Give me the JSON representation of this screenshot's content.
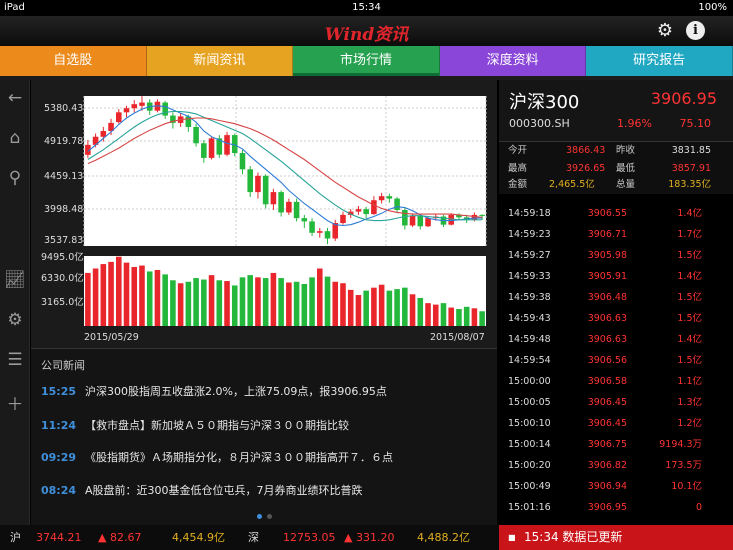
{
  "status_bar": {
    "device": "iPad",
    "time": "15:34",
    "battery": "100%"
  },
  "app": {
    "logo_text": "Wind资讯",
    "settings_icon": "gear-icon",
    "info_icon": "info-icon"
  },
  "tabs": [
    {
      "label": "自选股",
      "color": "#ec8a1c"
    },
    {
      "label": "新闻资讯",
      "color": "#e6a322"
    },
    {
      "label": "市场行情",
      "color": "#26a14f",
      "active": true
    },
    {
      "label": "深度资料",
      "color": "#8a46d8"
    },
    {
      "label": "研究报告",
      "color": "#20a7c1"
    }
  ],
  "sidebar_icons": [
    "back-arrow-icon",
    "home-icon",
    "search-icon",
    "chart-icon",
    "settings-icon",
    "list-icon",
    "add-icon"
  ],
  "chart": {
    "price_axis_labels": [
      "5380.43",
      "4919.78",
      "4459.13",
      "3998.48",
      "3537.83"
    ],
    "volume_axis_labels": [
      "9495.0亿",
      "6330.0亿",
      "3165.0亿"
    ],
    "start_date": "2015/05/29",
    "end_date": "2015/08/07"
  },
  "chart_data": {
    "type": "candlestick",
    "ylim": [
      3537.83,
      5380.43
    ],
    "volume_ylim": [
      0,
      9495.0
    ],
    "candles": [
      [
        4658,
        4780,
        4620,
        4840,
        7200
      ],
      [
        4780,
        4880,
        4750,
        4920,
        7800
      ],
      [
        4880,
        4950,
        4820,
        5000,
        8400
      ],
      [
        4950,
        5050,
        4900,
        5100,
        8700
      ],
      [
        5060,
        5180,
        5040,
        5220,
        9400
      ],
      [
        5180,
        5230,
        5120,
        5260,
        8600
      ],
      [
        5230,
        5280,
        5180,
        5330,
        8000
      ],
      [
        5260,
        5300,
        5200,
        5380,
        8200
      ],
      [
        5300,
        5200,
        5150,
        5340,
        7400
      ],
      [
        5200,
        5310,
        5180,
        5340,
        7600
      ],
      [
        5300,
        5140,
        5100,
        5320,
        7000
      ],
      [
        5140,
        5050,
        4980,
        5180,
        6200
      ],
      [
        5050,
        5130,
        5000,
        5170,
        5800
      ],
      [
        5130,
        5000,
        4940,
        5150,
        6000
      ],
      [
        5000,
        4800,
        4760,
        5040,
        6500
      ],
      [
        4800,
        4620,
        4560,
        4840,
        6300
      ],
      [
        4620,
        4860,
        4600,
        4880,
        6900
      ],
      [
        4860,
        4660,
        4620,
        4900,
        6200
      ],
      [
        4660,
        4900,
        4640,
        4940,
        6100
      ],
      [
        4900,
        4680,
        4640,
        4920,
        5500
      ],
      [
        4680,
        4480,
        4420,
        4720,
        6600
      ],
      [
        4480,
        4200,
        4140,
        4520,
        6900
      ],
      [
        4200,
        4400,
        4120,
        4440,
        6600
      ],
      [
        4400,
        4050,
        4000,
        4420,
        6500
      ],
      [
        4050,
        4200,
        3980,
        4240,
        7200
      ],
      [
        4200,
        3950,
        3900,
        4220,
        6500
      ],
      [
        3950,
        4080,
        3920,
        4120,
        5900
      ],
      [
        4080,
        3880,
        3840,
        4120,
        6000
      ],
      [
        3880,
        3840,
        3760,
        3920,
        5700
      ],
      [
        3840,
        3700,
        3660,
        3880,
        6600
      ],
      [
        3700,
        3720,
        3640,
        3760,
        7800
      ],
      [
        3720,
        3630,
        3560,
        3760,
        6700
      ],
      [
        3630,
        3820,
        3600,
        3860,
        6000
      ],
      [
        3820,
        3920,
        3800,
        3960,
        5800
      ],
      [
        3920,
        3960,
        3880,
        3990,
        4900
      ],
      [
        3960,
        3990,
        3920,
        4030,
        4200
      ],
      [
        3990,
        3930,
        3880,
        4020,
        4800
      ],
      [
        3930,
        4100,
        3920,
        4150,
        5200
      ],
      [
        4100,
        4150,
        4060,
        4190,
        5600
      ],
      [
        4150,
        4120,
        4070,
        4180,
        4800
      ],
      [
        4120,
        3980,
        3940,
        4140,
        5000
      ],
      [
        3980,
        3790,
        3740,
        4000,
        5200
      ],
      [
        3790,
        3910,
        3770,
        3940,
        4300
      ],
      [
        3910,
        3780,
        3740,
        3930,
        3800
      ],
      [
        3780,
        3880,
        3770,
        3900,
        3100
      ],
      [
        3880,
        3900,
        3850,
        3930,
        2900
      ],
      [
        3900,
        3800,
        3770,
        3920,
        3100
      ],
      [
        3800,
        3920,
        3790,
        3940,
        2500
      ],
      [
        3920,
        3890,
        3860,
        3940,
        2300
      ],
      [
        3890,
        3860,
        3820,
        3920,
        2600
      ],
      [
        3860,
        3920,
        3840,
        3950,
        2400
      ],
      [
        3920,
        3906.95,
        3857.91,
        3926.65,
        2000
      ]
    ],
    "ma_short": [
      4700,
      4780,
      4860,
      4940,
      5030,
      5110,
      5170,
      5220,
      5250,
      5260,
      5250,
      5210,
      5170,
      5130,
      5060,
      4950,
      4880,
      4840,
      4800,
      4780,
      4730,
      4640,
      4560,
      4480,
      4400,
      4320,
      4220,
      4140,
      4060,
      3990,
      3920,
      3850,
      3800,
      3790,
      3800,
      3830,
      3870,
      3900,
      3940,
      3990,
      4020,
      4010,
      3970,
      3920,
      3880,
      3860,
      3850,
      3850,
      3860,
      3870,
      3880,
      3880
    ],
    "ma_mid": [
      4600,
      4660,
      4720,
      4790,
      4860,
      4930,
      5000,
      5060,
      5110,
      5150,
      5180,
      5190,
      5190,
      5180,
      5160,
      5120,
      5080,
      5040,
      5000,
      4960,
      4920,
      4860,
      4790,
      4720,
      4650,
      4580,
      4500,
      4420,
      4340,
      4260,
      4180,
      4110,
      4040,
      3980,
      3930,
      3890,
      3860,
      3850,
      3850,
      3860,
      3880,
      3900,
      3910,
      3910,
      3900,
      3890,
      3880,
      3870,
      3860,
      3860,
      3860,
      3860
    ],
    "ma_long": [
      4550,
      4590,
      4640,
      4690,
      4740,
      4800,
      4860,
      4910,
      4960,
      5000,
      5040,
      5070,
      5090,
      5100,
      5110,
      5110,
      5100,
      5080,
      5060,
      5040,
      5010,
      4980,
      4940,
      4890,
      4840,
      4780,
      4720,
      4660,
      4600,
      4530,
      4460,
      4390,
      4320,
      4260,
      4200,
      4140,
      4090,
      4040,
      4000,
      3970,
      3950,
      3940,
      3930,
      3930,
      3930,
      3930,
      3930,
      3930,
      3920,
      3910,
      3900,
      3890
    ]
  },
  "news": {
    "section_title": "公司新闻",
    "items": [
      {
        "time": "15:25",
        "headline": "沪深300股指周五收盘涨2.0%，上涨75.09点，报3906.95点"
      },
      {
        "time": "11:24",
        "headline": "【救市盘点】新加坡Ａ５０期指与沪深３００期指比较"
      },
      {
        "time": "09:29",
        "headline": "《股指期货》Ａ场期指分化，８月沪深３００期指高开７．６点"
      },
      {
        "time": "08:24",
        "headline": "A股盘前：近300基金低仓位屯兵，7月券商业绩环比普跌"
      }
    ]
  },
  "quote": {
    "name": "沪深300",
    "price": "3906.95",
    "code": "000300.SH",
    "pct": "1.96%",
    "change": "75.10",
    "stats": {
      "open_label": "今开",
      "open": "3866.43",
      "prev_close_label": "昨收",
      "prev_close": "3831.85",
      "high_label": "最高",
      "high": "3926.65",
      "low_label": "最低",
      "low": "3857.91",
      "amount_label": "金额",
      "amount": "2,465.5亿",
      "volume_label": "总量",
      "volume": "183.35亿"
    },
    "ticks": [
      {
        "time": "14:59:18",
        "price": "3906.55",
        "vol": "1.4亿"
      },
      {
        "time": "14:59:23",
        "price": "3906.71",
        "vol": "1.7亿"
      },
      {
        "time": "14:59:27",
        "price": "3905.98",
        "vol": "1.5亿"
      },
      {
        "time": "14:59:33",
        "price": "3905.91",
        "vol": "1.4亿"
      },
      {
        "time": "14:59:38",
        "price": "3906.48",
        "vol": "1.5亿"
      },
      {
        "time": "14:59:43",
        "price": "3906.63",
        "vol": "1.5亿"
      },
      {
        "time": "14:59:48",
        "price": "3906.63",
        "vol": "1.4亿"
      },
      {
        "time": "14:59:54",
        "price": "3906.56",
        "vol": "1.5亿"
      },
      {
        "time": "15:00:00",
        "price": "3906.58",
        "vol": "1.1亿"
      },
      {
        "time": "15:00:05",
        "price": "3906.45",
        "vol": "1.3亿"
      },
      {
        "time": "15:00:10",
        "price": "3906.45",
        "vol": "1.2亿"
      },
      {
        "time": "15:00:14",
        "price": "3906.75",
        "vol": "9194.3万"
      },
      {
        "time": "15:00:20",
        "price": "3906.82",
        "vol": "173.5万"
      },
      {
        "time": "15:00:49",
        "price": "3906.94",
        "vol": "10.1亿"
      },
      {
        "time": "15:01:16",
        "price": "3906.95",
        "vol": "0"
      }
    ]
  },
  "bottom_bar": {
    "sh_label": "沪",
    "sh_value": "3744.21",
    "sh_change": "▲ 82.67",
    "sh_amount": "4,454.9亿",
    "sz_label": "深",
    "sz_value": "12753.05",
    "sz_change": "▲ 331.20",
    "sz_amount": "4,488.2亿",
    "update_text": "15:34 数据已更新"
  }
}
